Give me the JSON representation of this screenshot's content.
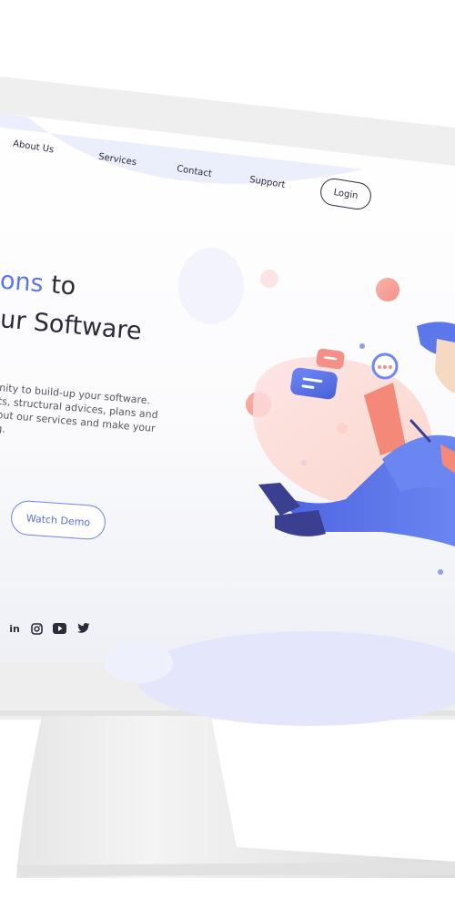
{
  "nav": {
    "items": [
      {
        "label": "About Us"
      },
      {
        "label": "Services"
      },
      {
        "label": "Contact"
      },
      {
        "label": "Support"
      }
    ],
    "login_label": "Login"
  },
  "hero": {
    "title_accent": "ons",
    "title_rest": " to",
    "title_line2": "ur Software",
    "description_lines": [
      "nity to build-up your software.",
      "ts, structural advices, plans and",
      "out our services and make your",
      "g."
    ],
    "watch_demo_label": "Watch Demo"
  },
  "social": {
    "icons": [
      "linkedin-icon",
      "instagram-icon",
      "youtube-icon",
      "twitter-icon"
    ],
    "linkedin_text": "in"
  },
  "colors": {
    "accent": "#5b77ea",
    "text": "#2b2b3b",
    "monitor": "#efefef",
    "illustration_blue": "#4a5fd8",
    "illustration_pink": "#f7a8a0"
  }
}
